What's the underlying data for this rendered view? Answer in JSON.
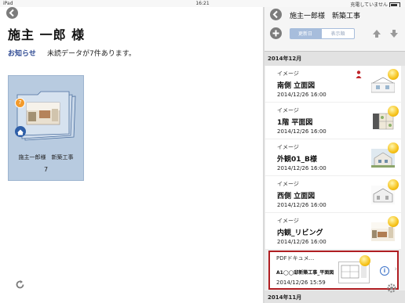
{
  "status": {
    "device": "iPad",
    "time": "16:21",
    "charge": "充電していません"
  },
  "left": {
    "title": "施主 一郎 様",
    "notice_label": "お知らせ",
    "notice_text": "未読データが7件あります。",
    "tile": {
      "name": "施主一郎様　新築工事",
      "count": "7",
      "badge": "7"
    }
  },
  "right": {
    "header_title": "施主一郎様　新築工事",
    "segments": [
      "更新日",
      "表示順"
    ],
    "sections": [
      "2014年12月",
      "2014年11月"
    ],
    "items": [
      {
        "category": "イメージ",
        "name": "南側 立面図",
        "date": "2014/12/26 16:00"
      },
      {
        "category": "イメージ",
        "name": "1階 平面図",
        "date": "2014/12/26 16:00"
      },
      {
        "category": "イメージ",
        "name": "外観01_B様",
        "date": "2014/12/26 16:00"
      },
      {
        "category": "イメージ",
        "name": "西側 立面図",
        "date": "2014/12/26 16:00"
      },
      {
        "category": "イメージ",
        "name": "内観_リビング",
        "date": "2014/12/26 16:00"
      },
      {
        "category": "PDFドキュメ...",
        "name": "A1◯◯邸新築工事_平面図",
        "date": "2014/12/26 15:59"
      }
    ]
  },
  "colors": {
    "accent": "#2f4a93",
    "selected_border": "#b01e22",
    "tile_bg": "#b8cbe0"
  },
  "icons": [
    "back-icon",
    "refresh-icon",
    "add-icon",
    "arrow-up-icon",
    "arrow-down-icon",
    "home-icon",
    "info-icon",
    "chevron-right-icon",
    "gear-icon",
    "person-icon"
  ]
}
